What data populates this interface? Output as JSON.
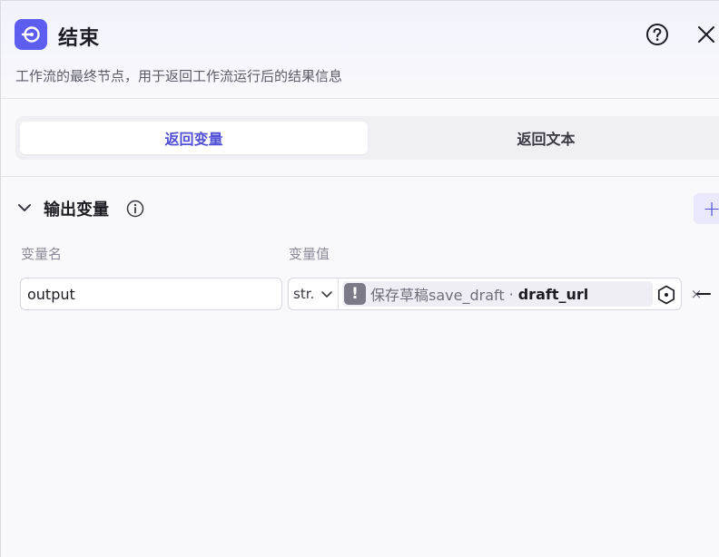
{
  "header": {
    "title": "结束",
    "description": "工作流的最终节点，用于返回工作流运行后的结果信息",
    "node_icon": "end-node-icon",
    "help_icon": "question-circle-icon",
    "close_icon": "close-icon"
  },
  "tabs": [
    {
      "label": "返回变量",
      "active": true
    },
    {
      "label": "返回文本",
      "active": false
    }
  ],
  "output_section": {
    "title": "输出变量",
    "add_label": "+",
    "columns": {
      "name": "变量名",
      "value": "变量值"
    },
    "rows": [
      {
        "name": "output",
        "type": "str.",
        "ref_node": "保存草稿save_draft",
        "ref_sep": "·",
        "ref_field": "draft_url",
        "ref_close": "×",
        "status_icon": "warning-icon",
        "warning_glyph": "!"
      }
    ]
  },
  "colors": {
    "accent": "#5d5ef0",
    "accent_text": "#5150d6",
    "background": "#f9f9fc"
  }
}
